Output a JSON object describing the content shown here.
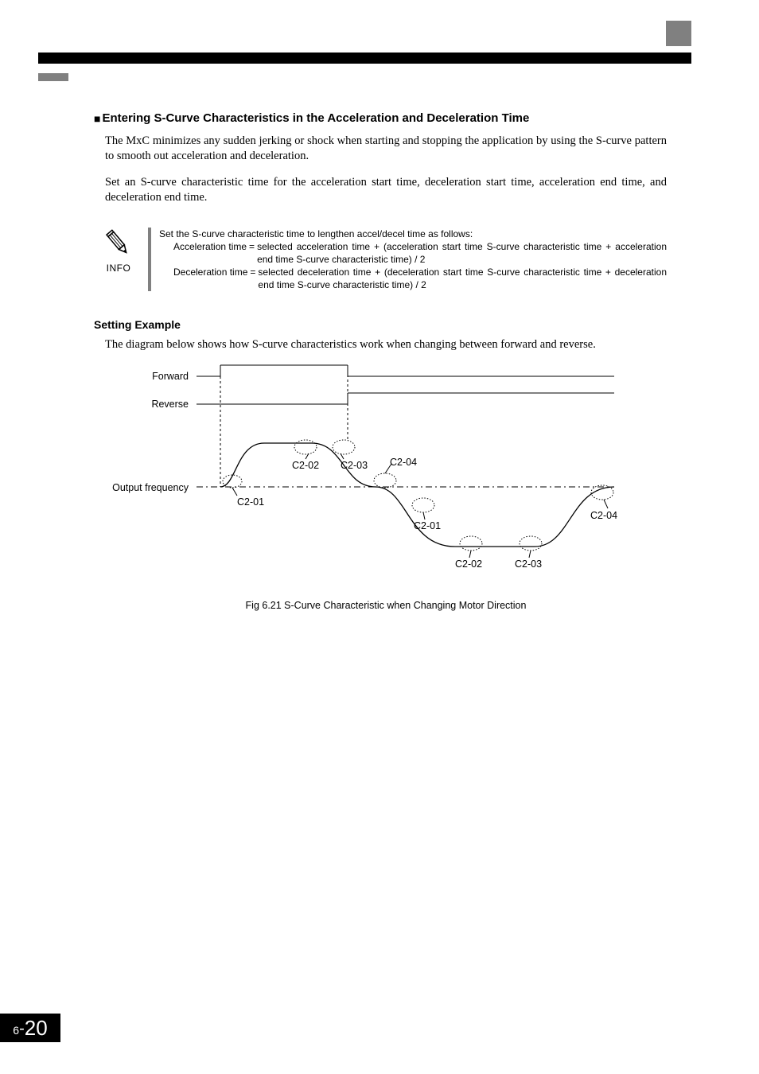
{
  "heading1": "Entering S-Curve Characteristics in the Acceleration and Deceleration Time",
  "para1": "The MxC minimizes any sudden jerking or shock when starting and stopping the application by using the S-curve pattern to smooth out acceleration and deceleration.",
  "para2": "Set an S-curve characteristic time for the acceleration start time, deceleration start time, acceleration end time, and deceleration end time.",
  "info": {
    "label": "INFO",
    "lead": "Set the S-curve characteristic time to lengthen accel/decel time as follows:",
    "accel_lhs": "Acceleration time",
    "accel_rhs": "selected acceleration time + (acceleration start time S-curve characteristic time + acceleration end time S-curve characteristic time) / 2",
    "decel_lhs": "Deceleration time",
    "decel_rhs": "selected deceleration time + (deceleration start time S-curve characteristic time + deceleration end time S-curve characteristic time) / 2"
  },
  "heading2": "Setting Example",
  "para3": "The diagram below shows how S-curve characteristics work when changing between forward and reverse.",
  "diagram": {
    "forward": "Forward",
    "reverse": "Reverse",
    "output_freq": "Output frequency",
    "c201": "C2-01",
    "c202": "C2-02",
    "c203": "C2-03",
    "c204": "C2-04"
  },
  "caption": "Fig 6.21  S-Curve Characteristic when Changing Motor Direction",
  "page": {
    "chapter": "6",
    "sep": "-",
    "num": "20"
  }
}
